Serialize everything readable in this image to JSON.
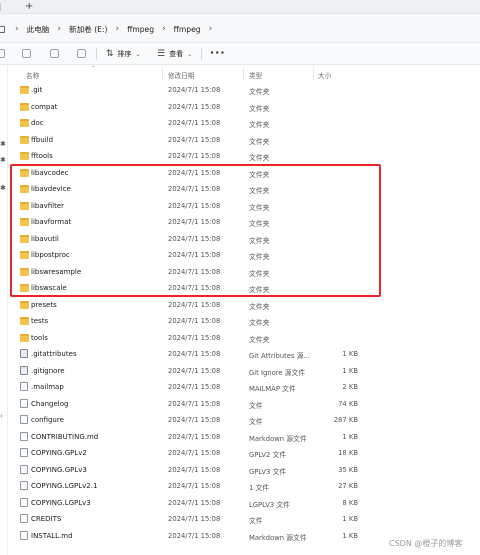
{
  "tabbar": {
    "new_tab": "+"
  },
  "breadcrumb": {
    "items": [
      "此电脑",
      "新加卷 (E:)",
      "ffmpeg",
      "ffmpeg"
    ],
    "separator": "›"
  },
  "toolbar": {
    "sort_label": "排序",
    "view_label": "查看",
    "more": "···"
  },
  "columns": {
    "name": "名称",
    "date": "修改日期",
    "type": "类型",
    "size": "大小"
  },
  "files": [
    {
      "name": ".git",
      "date": "2024/7/1 15:08",
      "type": "文件夹",
      "size": "",
      "kind": "folder"
    },
    {
      "name": "compat",
      "date": "2024/7/1 15:08",
      "type": "文件夹",
      "size": "",
      "kind": "folder"
    },
    {
      "name": "doc",
      "date": "2024/7/1 15:08",
      "type": "文件夹",
      "size": "",
      "kind": "folder"
    },
    {
      "name": "ffbuild",
      "date": "2024/7/1 15:08",
      "type": "文件夹",
      "size": "",
      "kind": "folder"
    },
    {
      "name": "fftools",
      "date": "2024/7/1 15:08",
      "type": "文件夹",
      "size": "",
      "kind": "folder"
    },
    {
      "name": "libavcodec",
      "date": "2024/7/1 15:08",
      "type": "文件夹",
      "size": "",
      "kind": "folder"
    },
    {
      "name": "libavdevice",
      "date": "2024/7/1 15:08",
      "type": "文件夹",
      "size": "",
      "kind": "folder"
    },
    {
      "name": "libavfilter",
      "date": "2024/7/1 15:08",
      "type": "文件夹",
      "size": "",
      "kind": "folder"
    },
    {
      "name": "libavformat",
      "date": "2024/7/1 15:08",
      "type": "文件夹",
      "size": "",
      "kind": "folder"
    },
    {
      "name": "libavutil",
      "date": "2024/7/1 15:08",
      "type": "文件夹",
      "size": "",
      "kind": "folder"
    },
    {
      "name": "libpostproc",
      "date": "2024/7/1 15:08",
      "type": "文件夹",
      "size": "",
      "kind": "folder"
    },
    {
      "name": "libswresample",
      "date": "2024/7/1 15:08",
      "type": "文件夹",
      "size": "",
      "kind": "folder"
    },
    {
      "name": "libswscale",
      "date": "2024/7/1 15:08",
      "type": "文件夹",
      "size": "",
      "kind": "folder"
    },
    {
      "name": "presets",
      "date": "2024/7/1 15:08",
      "type": "文件夹",
      "size": "",
      "kind": "folder"
    },
    {
      "name": "tests",
      "date": "2024/7/1 15:08",
      "type": "文件夹",
      "size": "",
      "kind": "folder"
    },
    {
      "name": "tools",
      "date": "2024/7/1 15:08",
      "type": "文件夹",
      "size": "",
      "kind": "folder"
    },
    {
      "name": ".gitattributes",
      "date": "2024/7/1 15:08",
      "type": "Git Attributes 源...",
      "size": "1 KB",
      "kind": "git"
    },
    {
      "name": ".gitignore",
      "date": "2024/7/1 15:08",
      "type": "Git Ignore 源文件",
      "size": "1 KB",
      "kind": "git"
    },
    {
      "name": ".mailmap",
      "date": "2024/7/1 15:08",
      "type": "MAILMAP 文件",
      "size": "2 KB",
      "kind": "file"
    },
    {
      "name": "Changelog",
      "date": "2024/7/1 15:08",
      "type": "文件",
      "size": "74 KB",
      "kind": "file"
    },
    {
      "name": "configure",
      "date": "2024/7/1 15:08",
      "type": "文件",
      "size": "287 KB",
      "kind": "file"
    },
    {
      "name": "CONTRIBUTING.md",
      "date": "2024/7/1 15:08",
      "type": "Markdown 源文件",
      "size": "1 KB",
      "kind": "file"
    },
    {
      "name": "COPYING.GPLv2",
      "date": "2024/7/1 15:08",
      "type": "GPLV2 文件",
      "size": "18 KB",
      "kind": "file"
    },
    {
      "name": "COPYING.GPLv3",
      "date": "2024/7/1 15:08",
      "type": "GPLV3 文件",
      "size": "35 KB",
      "kind": "file"
    },
    {
      "name": "COPYING.LGPLv2.1",
      "date": "2024/7/1 15:08",
      "type": "1 文件",
      "size": "27 KB",
      "kind": "file"
    },
    {
      "name": "COPYING.LGPLv3",
      "date": "2024/7/1 15:08",
      "type": "LGPLV3 文件",
      "size": "8 KB",
      "kind": "file"
    },
    {
      "name": "CREDITS",
      "date": "2024/7/1 15:08",
      "type": "文件",
      "size": "1 KB",
      "kind": "file"
    },
    {
      "name": "INSTALL.md",
      "date": "2024/7/1 15:08",
      "type": "Markdown 源文件",
      "size": "1 KB",
      "kind": "file"
    }
  ],
  "watermark": "CSDN @橙子的博客",
  "colors": {
    "highlight": "#e5262b",
    "folder": "#f2c34d"
  }
}
